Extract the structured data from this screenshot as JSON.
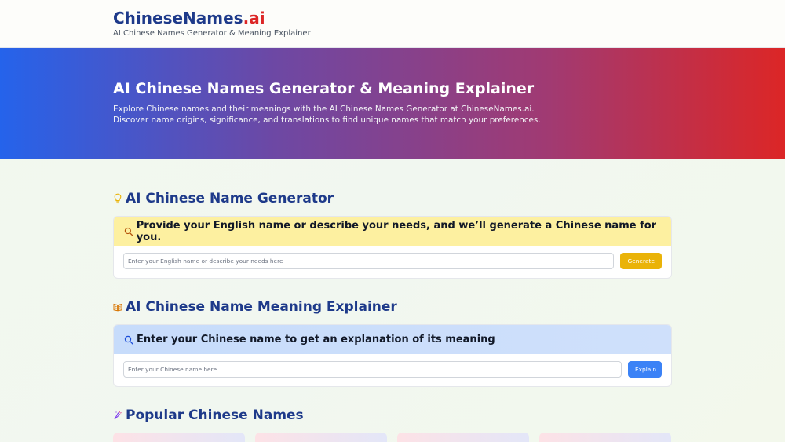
{
  "header": {
    "logo_main": "ChineseNames",
    "logo_suffix": ".ai",
    "tagline": "AI Chinese Names Generator & Meaning Explainer"
  },
  "hero": {
    "title": "AI Chinese Names Generator & Meaning Explainer",
    "description_line1": "Explore Chinese names and their meanings with the AI Chinese Names Generator at ChineseNames.ai.",
    "description_line2": "Discover name origins, significance, and translations to find unique names that match your preferences."
  },
  "generator": {
    "section_title": "AI Chinese Name Generator",
    "icon": "lightbulb-icon",
    "prompt": "Provide your English name or describe your needs, and we’ll generate a Chinese name for you.",
    "input_placeholder": "Enter your English name or describe your needs here",
    "input_value": "",
    "button_label": "Generate"
  },
  "explainer": {
    "section_title": "AI Chinese Name Meaning Explainer",
    "icon": "book-icon",
    "prompt": "Enter your Chinese name to get an explanation of its meaning",
    "input_placeholder": "Enter your Chinese name here",
    "input_value": "",
    "button_label": "Explain"
  },
  "popular": {
    "section_title": "Popular Chinese Names",
    "icon": "sparkle-icon"
  },
  "colors": {
    "brand_blue": "#1e3a8a",
    "brand_red": "#dc2626",
    "generate_button": "#eab308",
    "explain_button": "#3b82f6"
  }
}
